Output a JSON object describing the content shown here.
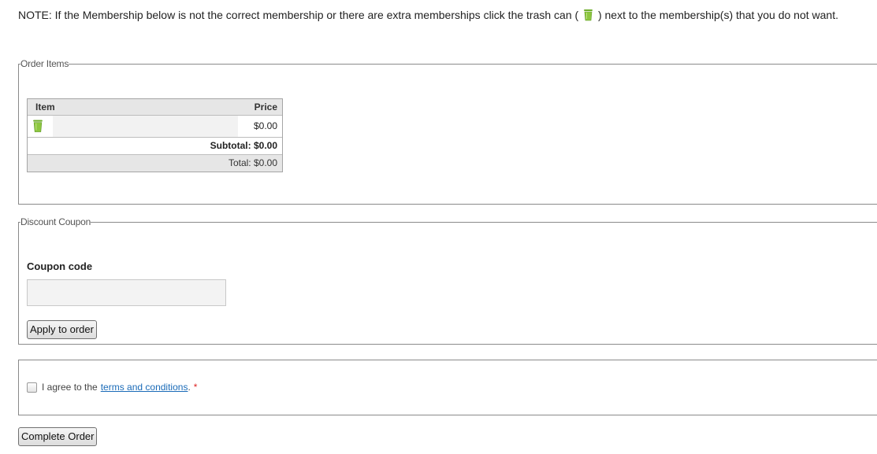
{
  "note": {
    "before_icon": "NOTE: If the Membership below is not the correct membership or there are extra memberships click the trash can (",
    "after_icon": ") next to the membership(s) that you do not want."
  },
  "order_items": {
    "legend": "Order Items",
    "col_item": "Item",
    "col_price": "Price",
    "rows": [
      {
        "icon": "trash-can-icon",
        "price": "$0.00"
      }
    ],
    "subtotal_label": "Subtotal:",
    "subtotal_value": "$0.00",
    "total_label": "Total:",
    "total_value": "$0.00"
  },
  "discount_coupon": {
    "legend": "Discount Coupon",
    "label": "Coupon code",
    "value": "",
    "placeholder": "",
    "apply_button": "Apply to order"
  },
  "terms": {
    "prefix": "I agree to the",
    "link": "terms and conditions",
    "suffix": ".",
    "required_mark": "*",
    "checked": false
  },
  "complete_button": "Complete Order",
  "colors": {
    "trash_icon": "#8dc63f",
    "link": "#1a6bb8",
    "required": "#dd2222"
  }
}
